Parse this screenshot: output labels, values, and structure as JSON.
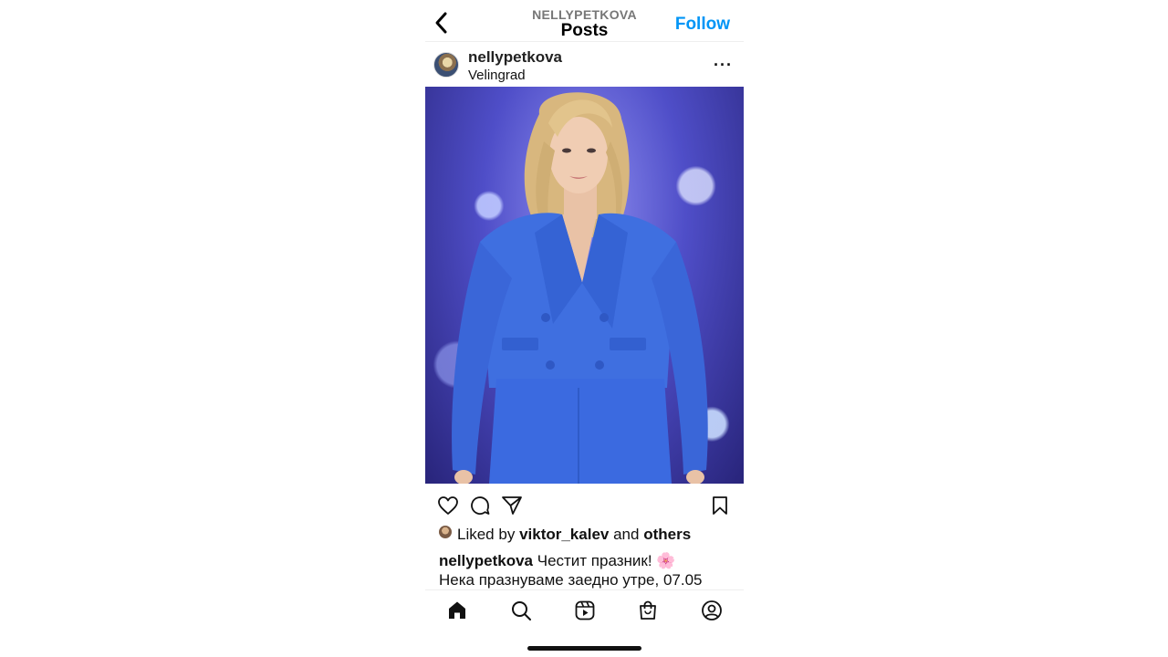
{
  "header": {
    "username": "NELLYPETKOVA",
    "title": "Posts",
    "follow_label": "Follow"
  },
  "post": {
    "username": "nellypetkova",
    "location": "Velingrad",
    "more_label": "···",
    "likes": {
      "prefix": "Liked by",
      "liker": "viktor_kalev",
      "conjunction": "and",
      "others": "others"
    },
    "caption": {
      "username": "nellypetkova",
      "line1": "Честит празник! 🌸",
      "line2": "Нека празнуваме заедно утре, 07.05"
    }
  },
  "icons": {
    "back": "chevron-left-icon",
    "like": "heart-icon",
    "comment": "comment-icon",
    "share": "paper-plane-icon",
    "save": "bookmark-icon",
    "nav": [
      "home-icon",
      "search-icon",
      "reels-icon",
      "shop-icon",
      "profile-icon"
    ]
  },
  "colors": {
    "accent": "#0095f6",
    "suit": "#3f6fe0"
  }
}
